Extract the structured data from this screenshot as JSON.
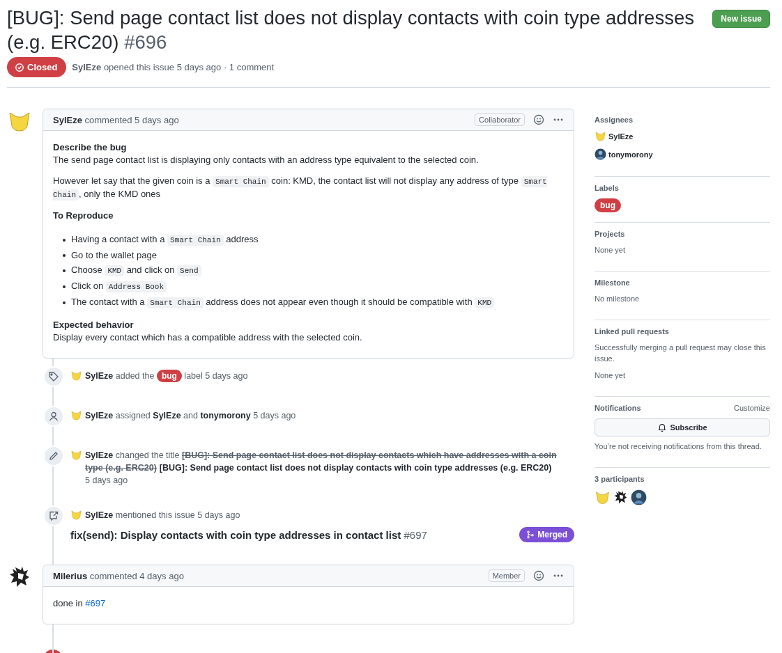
{
  "issue": {
    "title": "[BUG]: Send page contact list does not display contacts with coin type addresses (e.g. ERC20)",
    "number": "#696",
    "state": "Closed",
    "author": "SylEze",
    "meta": "opened this issue 5 days ago · 1 comment",
    "new_issue": "New issue"
  },
  "timeline": [
    {
      "kind": "comment",
      "author": "SylEze",
      "meta": "commented 5 days ago",
      "role": "Collaborator",
      "blocks": [
        {
          "kind": "heading",
          "text": "Describe the bug"
        },
        {
          "kind": "paragraph",
          "parts": [
            {
              "kind": "text",
              "text": "The send page contact list is displaying only contacts with an address type equivalent to the selected coin."
            }
          ]
        },
        {
          "kind": "paragraph",
          "parts": [
            {
              "kind": "text",
              "text": "However let say that the given coin is a "
            },
            {
              "kind": "code",
              "text": "Smart Chain"
            },
            {
              "kind": "text",
              "text": " coin: KMD, the contact list will not display any address of type "
            },
            {
              "kind": "code",
              "text": "Smart Chain"
            },
            {
              "kind": "text",
              "text": ", only the KMD ones"
            }
          ]
        },
        {
          "kind": "title",
          "text": "To Reproduce"
        },
        {
          "kind": "list",
          "items": [
            [
              {
                "kind": "text",
                "text": "Having a contact with a "
              },
              {
                "kind": "code",
                "text": "Smart Chain"
              },
              {
                "kind": "text",
                "text": " address"
              }
            ],
            [
              {
                "kind": "text",
                "text": "Go to the wallet page"
              }
            ],
            [
              {
                "kind": "text",
                "text": "Choose "
              },
              {
                "kind": "code",
                "text": "KMD"
              },
              {
                "kind": "text",
                "text": " and click on "
              },
              {
                "kind": "code",
                "text": "Send"
              }
            ],
            [
              {
                "kind": "text",
                "text": "Click on "
              },
              {
                "kind": "code",
                "text": "Address Book"
              }
            ],
            [
              {
                "kind": "text",
                "text": "The contact with a "
              },
              {
                "kind": "code",
                "text": "Smart Chain"
              },
              {
                "kind": "text",
                "text": " address does not appear even though it should be compatible with "
              },
              {
                "kind": "code",
                "text": "KMD"
              }
            ]
          ]
        },
        {
          "kind": "heading",
          "text": "Expected behavior"
        },
        {
          "kind": "paragraph",
          "parts": [
            {
              "kind": "text",
              "text": "Display every contact which has a compatible address with the selected coin."
            }
          ]
        }
      ]
    },
    {
      "kind": "labeled",
      "parts": [
        {
          "kind": "bold",
          "text": "SylEze"
        },
        {
          "kind": "text",
          "text": " added the "
        },
        {
          "kind": "label",
          "text": "bug",
          "color": "#cf3f44"
        },
        {
          "kind": "text",
          "text": " label 5 days ago"
        }
      ]
    },
    {
      "kind": "assigned",
      "parts": [
        {
          "kind": "bold",
          "text": "SylEze"
        },
        {
          "kind": "text",
          "text": " assigned "
        },
        {
          "kind": "bold",
          "text": "SylEze"
        },
        {
          "kind": "text",
          "text": " and "
        },
        {
          "kind": "bold",
          "text": "tonymorony"
        },
        {
          "kind": "text",
          "text": " 5 days ago"
        }
      ]
    },
    {
      "kind": "renamed",
      "parts": [
        {
          "kind": "bold",
          "text": "SylEze"
        },
        {
          "kind": "text",
          "text": " changed the title "
        },
        {
          "kind": "strike",
          "text": "[BUG]: Send page contact list does not display contacts which have addresses with a coin type (e.g. ERC20)"
        },
        {
          "kind": "bold",
          "text": "[BUG]: Send page contact list does not display contacts with coin type addresses (e.g. ERC20)"
        },
        {
          "kind": "time",
          "text": "5 days ago"
        }
      ]
    },
    {
      "kind": "mentioned",
      "parts": [
        {
          "kind": "bold",
          "text": "SylEze"
        },
        {
          "kind": "text",
          "text": " mentioned this issue 5 days ago"
        }
      ],
      "pr": {
        "title": "fix(send): Display contacts with coin type addresses in contact list",
        "number": "#697",
        "state": "Merged"
      }
    },
    {
      "kind": "comment",
      "author": "Milerius",
      "meta": "commented 4 days ago",
      "role": "Member",
      "blocks": [
        {
          "kind": "paragraph",
          "parts": [
            {
              "kind": "text",
              "text": "done in "
            },
            {
              "kind": "link",
              "text": "#697"
            }
          ]
        }
      ]
    },
    {
      "kind": "closed"
    }
  ],
  "sidebar": [
    {
      "kind": "people",
      "title": "Assignees",
      "people": [
        {
          "name": "SylEze"
        },
        {
          "name": "tonymorony"
        }
      ]
    },
    {
      "kind": "labels",
      "title": "Labels",
      "labels": [
        {
          "text": "bug",
          "color": "#cf3f44"
        }
      ]
    },
    {
      "kind": "text",
      "title": "Projects",
      "lines": [
        "None yet"
      ]
    },
    {
      "kind": "text",
      "title": "Milestone",
      "lines": [
        "No milestone"
      ]
    },
    {
      "kind": "text",
      "title": "Linked pull requests",
      "lines": [
        "Successfully merging a pull request may close this issue.",
        "None yet"
      ]
    },
    {
      "kind": "notifications",
      "title": "Notifications",
      "action": "Customize",
      "button": "Subscribe",
      "note": "You’re not receiving notifications from this thread."
    },
    {
      "kind": "participants",
      "title": "3 participants"
    }
  ]
}
